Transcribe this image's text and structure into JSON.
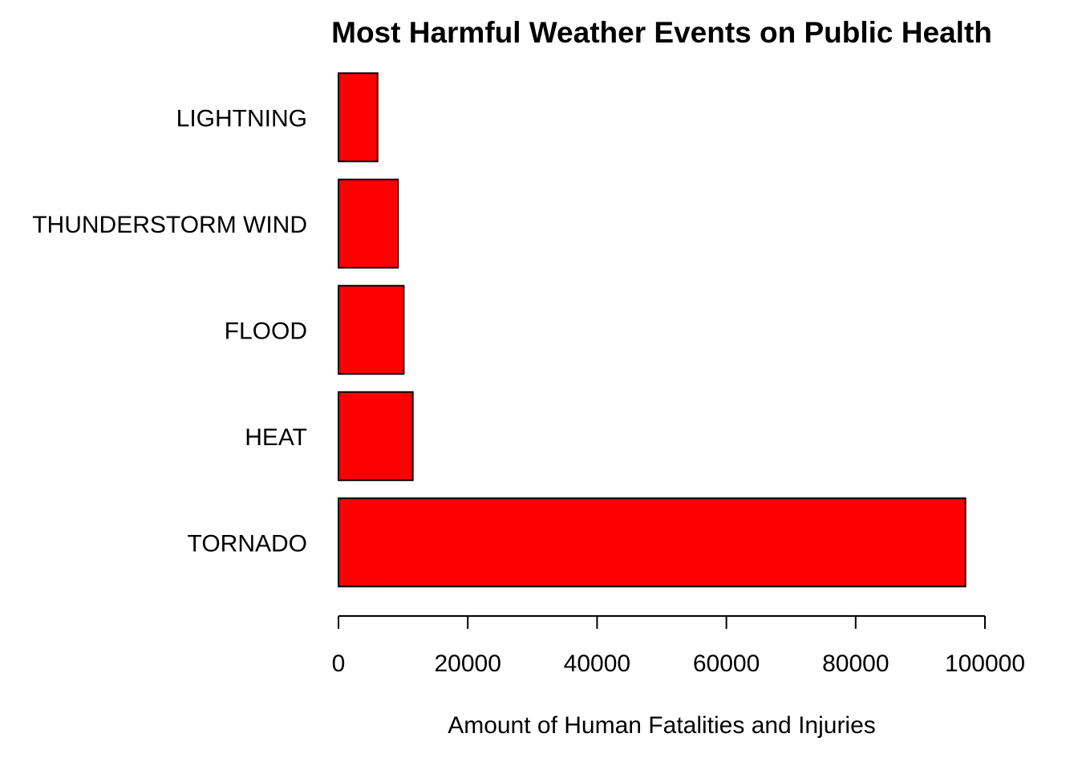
{
  "chart_data": {
    "type": "bar",
    "orientation": "horizontal",
    "title": "Most Harmful Weather Events on Public Health",
    "xlabel": "Amount of Human Fatalities and Injuries",
    "ylabel": "",
    "categories": [
      "TORNADO",
      "HEAT",
      "FLOOD",
      "THUNDERSTORM WIND",
      "LIGHTNING"
    ],
    "values": [
      96979,
      11500,
      10100,
      9200,
      6046
    ],
    "xlim": [
      0,
      100000
    ],
    "xticks": [
      "0",
      "20000",
      "40000",
      "60000",
      "80000",
      "100000"
    ],
    "bar_color": "#ff0000",
    "bar_border_color": "#000000",
    "grid": false,
    "legend": "none"
  }
}
